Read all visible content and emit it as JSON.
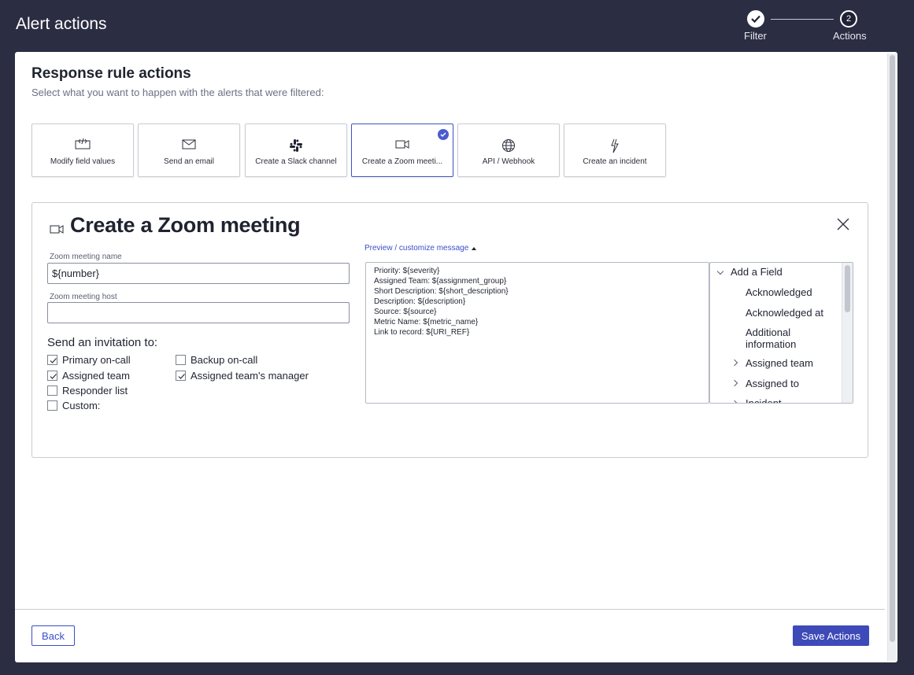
{
  "header": {
    "title": "Alert actions",
    "steps": [
      {
        "number": "1",
        "label": "Filter",
        "state": "completed"
      },
      {
        "number": "2",
        "label": "Actions",
        "state": "current"
      }
    ]
  },
  "section": {
    "title": "Response rule actions",
    "subtitle": "Select what you want to happen with the alerts that were filtered:"
  },
  "action_cards": [
    {
      "label": "Modify field values",
      "icon": "code-edit-icon",
      "selected": false
    },
    {
      "label": "Send an email",
      "icon": "envelope-icon",
      "selected": false
    },
    {
      "label": "Create a Slack channel",
      "icon": "slack-icon",
      "selected": false
    },
    {
      "label": "Create a Zoom meeti...",
      "icon": "video-camera-icon",
      "selected": true
    },
    {
      "label": "API / Webhook",
      "icon": "globe-icon",
      "selected": false
    },
    {
      "label": "Create an incident",
      "icon": "lightning-cursor-icon",
      "selected": false
    }
  ],
  "config": {
    "title": "Create a Zoom meeting",
    "meeting_name_label": "Zoom meeting name",
    "meeting_name_value": "${number}",
    "meeting_host_label": "Zoom meeting host",
    "meeting_host_value": "",
    "invitation_label": "Send an invitation to:",
    "checkboxes": [
      {
        "label": "Primary on-call",
        "checked": true
      },
      {
        "label": "Backup on-call",
        "checked": false
      },
      {
        "label": "Assigned team",
        "checked": true
      },
      {
        "label": "Assigned team's manager",
        "checked": true
      },
      {
        "label": "Responder list",
        "checked": false
      },
      {
        "label": "Custom:",
        "checked": false
      }
    ],
    "preview_link": "Preview / customize message",
    "message_lines": [
      "Priority: ${severity}",
      "Assigned Team: ${assignment_group}",
      "Short Description: ${short_description}",
      "Description: ${description}",
      "Source: ${source}",
      "Metric Name: ${metric_name}",
      "Link to record: ${URI_REF}"
    ],
    "field_tree": {
      "root": "Add a Field",
      "items": [
        {
          "label": "Acknowledged",
          "expandable": false
        },
        {
          "label": "Acknowledged at",
          "expandable": false
        },
        {
          "label": "Additional information",
          "expandable": false
        },
        {
          "label": "Assigned team",
          "expandable": true
        },
        {
          "label": "Assigned to",
          "expandable": true
        },
        {
          "label": "Incident",
          "expandable": true
        }
      ]
    }
  },
  "footer": {
    "back_label": "Back",
    "save_label": "Save Actions"
  },
  "colors": {
    "background": "#2b2d42",
    "accent": "#3e4ab8",
    "link": "#3a4fc7"
  }
}
